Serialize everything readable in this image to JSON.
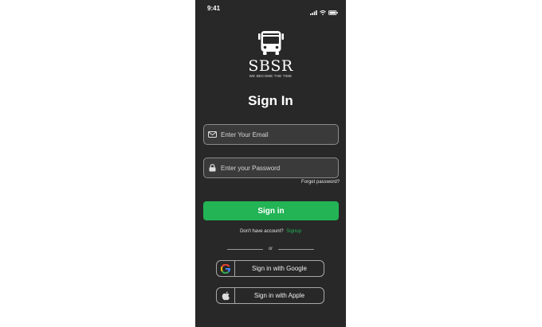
{
  "status_bar": {
    "time": "9:41"
  },
  "logo": {
    "brand": "SBSR",
    "tagline": "WE BECOME THE TIME"
  },
  "title": "Sign In",
  "email": {
    "placeholder": "Enter Your Email"
  },
  "password": {
    "placeholder": "Enter your Password"
  },
  "forgot": "Forget password?",
  "signin_button": "Sign in",
  "account": {
    "prompt": "Don't have account?",
    "link": "Signup"
  },
  "divider": "or",
  "social": {
    "google": "Sign in with Google",
    "apple": "Sign in with Apple"
  },
  "colors": {
    "background": "#282828",
    "accent": "#22b455"
  }
}
